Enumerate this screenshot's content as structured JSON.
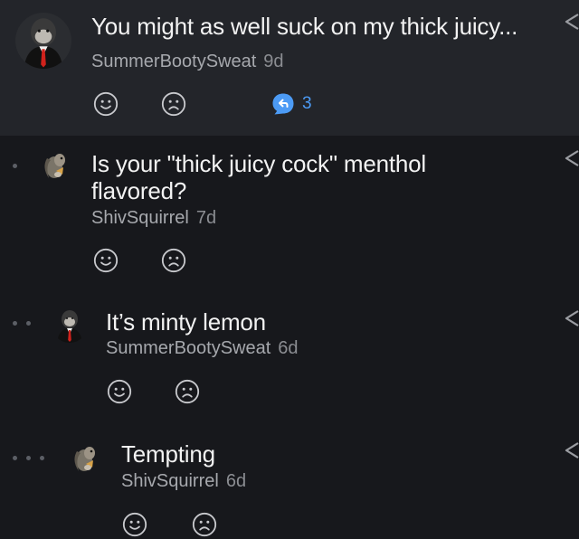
{
  "comments": [
    {
      "text": "You might as well suck on my thick juicy...",
      "author": "SummerBootySweat",
      "age": "9d",
      "replies": "3",
      "depth": 0
    },
    {
      "text": "Is your \"thick juicy cock\" menthol flavored?",
      "author": "ShivSquirrel",
      "age": "7d",
      "depth": 1
    },
    {
      "text": "It’s minty lemon",
      "author": "SummerBootySweat",
      "age": "6d",
      "depth": 2
    },
    {
      "text": "Tempting",
      "author": "ShivSquirrel",
      "age": "6d",
      "depth": 3
    }
  ],
  "icons": {
    "like": "smile-icon",
    "dislike": "frown-icon",
    "reply": "reply-bubble-icon",
    "share": "share-icon"
  },
  "colors": {
    "background": "#17181c",
    "highlight_row": "#23252a",
    "reply_accent": "#4c9bf5"
  }
}
